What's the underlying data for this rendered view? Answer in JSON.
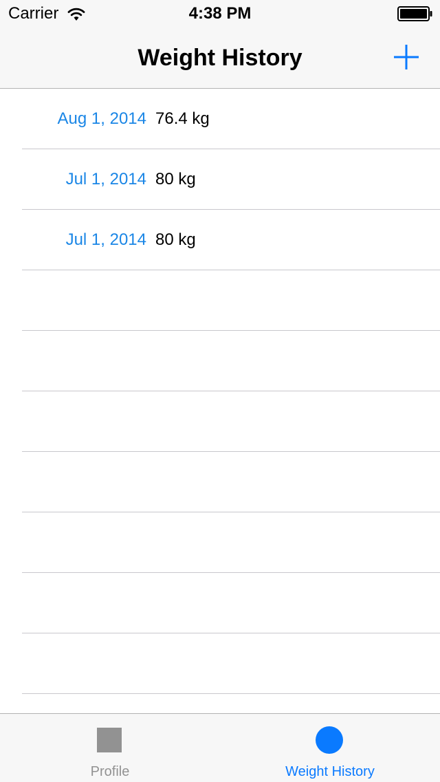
{
  "status_bar": {
    "carrier": "Carrier",
    "time": "4:38 PM",
    "wifi_icon": "wifi-icon",
    "battery_icon": "battery-icon"
  },
  "nav_bar": {
    "title": "Weight History",
    "add_icon": "plus-icon",
    "accent_color": "#0a7aff"
  },
  "table": {
    "rows": [
      {
        "date": "Aug 1, 2014",
        "weight": "76.4 kg"
      },
      {
        "date": "Jul 1, 2014",
        "weight": "80 kg"
      },
      {
        "date": "Jul 1, 2014",
        "weight": "80 kg"
      },
      {
        "date": "",
        "weight": ""
      },
      {
        "date": "",
        "weight": ""
      },
      {
        "date": "",
        "weight": ""
      },
      {
        "date": "",
        "weight": ""
      },
      {
        "date": "",
        "weight": ""
      },
      {
        "date": "",
        "weight": ""
      },
      {
        "date": "",
        "weight": ""
      },
      {
        "date": "",
        "weight": ""
      }
    ],
    "date_color": "#1a86e6"
  },
  "tab_bar": {
    "tabs": [
      {
        "label": "Profile",
        "icon": "square-icon",
        "selected": false
      },
      {
        "label": "Weight History",
        "icon": "circle-icon",
        "selected": true
      }
    ]
  }
}
